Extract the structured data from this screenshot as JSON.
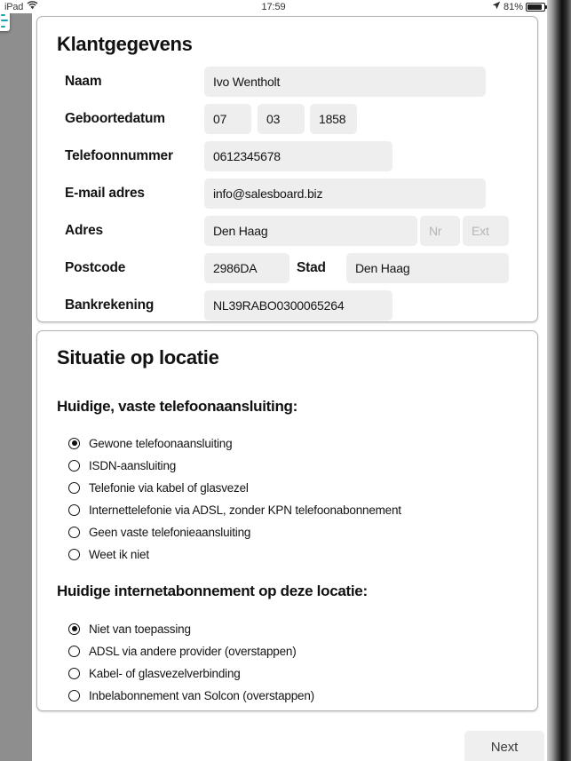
{
  "statusbar": {
    "device": "iPad",
    "wifi_icon": "wifi-icon",
    "time": "17:59",
    "location_icon": "location-arrow-icon",
    "battery_percent": "81%",
    "battery_icon": "battery-icon",
    "battery_level": 80
  },
  "sidetab": {
    "icon": "document-list-icon",
    "accent_color": "#1aa3b0"
  },
  "customer_card": {
    "title": "Klantgegevens",
    "fields": {
      "naam": {
        "label": "Naam",
        "value": "Ivo Wentholt"
      },
      "geboortedatum": {
        "label": "Geboortedatum",
        "day": "07",
        "month": "03",
        "year": "1858"
      },
      "telefoonnummer": {
        "label": "Telefoonnummer",
        "value": "0612345678"
      },
      "email": {
        "label": "E-mail adres",
        "value": "info@salesboard.biz"
      },
      "adres": {
        "label": "Adres",
        "street_value": "Den Haag",
        "nr_placeholder": "Nr",
        "nr_value": "",
        "ext_placeholder": "Ext",
        "ext_value": ""
      },
      "postcode": {
        "label": "Postcode",
        "value": "2986DA"
      },
      "stad": {
        "label": "Stad",
        "value": "Den Haag"
      },
      "bankrekening": {
        "label": "Bankrekening",
        "value": "NL39RABO0300065264"
      }
    }
  },
  "situation_card": {
    "title": "Situatie op locatie",
    "groups": [
      {
        "heading": "Huidige, vaste telefoonaansluiting:",
        "selected_index": 0,
        "options": [
          "Gewone telefoonaansluiting",
          "ISDN-aansluiting",
          "Telefonie via kabel of glasvezel",
          "Internettelefonie via ADSL, zonder KPN telefoonabonnement",
          "Geen vaste telefonieaansluiting",
          "Weet ik niet"
        ]
      },
      {
        "heading": "Huidige internetabonnement op deze locatie:",
        "selected_index": 0,
        "options": [
          "Niet van toepassing",
          "ADSL via andere provider (overstappen)",
          "Kabel- of glasvezelverbinding",
          "Inbelabonnement van Solcon (overstappen)"
        ]
      }
    ]
  },
  "footer": {
    "next_label": "Next"
  }
}
